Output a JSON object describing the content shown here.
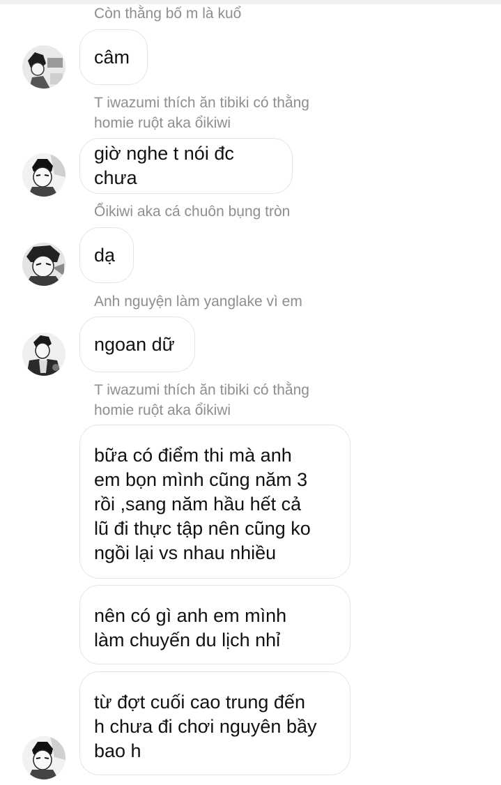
{
  "messages": [
    {
      "sender": "Còn thằng bố m là kuổ"
    },
    {
      "text": "câm"
    },
    {
      "sender": "T iwazumi thích ăn tibiki có thằng\nhomie ruột aka ổikiwi"
    },
    {
      "text": "giờ nghe t nói đc chưa"
    },
    {
      "sender": "Ổikiwi aka cá chuôn bụng tròn"
    },
    {
      "text": "dạ"
    },
    {
      "sender": "Anh nguyện làm yanglake vì em"
    },
    {
      "text": "ngoan dữ"
    },
    {
      "sender": "T iwazumi thích ăn tibiki có thằng\nhomie ruột aka ổikiwi"
    },
    {
      "text": "bữa có điểm thi mà anh\nem bọn mình cũng năm 3\nrồi ,sang năm hầu hết cả\nlũ đi thực tập nên cũng ko\nngồi lại vs nhau nhiều"
    },
    {
      "text": "nên có gì anh em mình\nlàm chuyến du lịch nhỉ"
    },
    {
      "text": "từ đợt cuối cao trung đến\nh chưa đi chơi nguyên bầy\nbao h"
    }
  ],
  "avatars": [
    {
      "icon": "manga-avatar-icon"
    },
    {
      "icon": "manga-avatar-icon"
    },
    {
      "icon": "manga-avatar-icon"
    },
    {
      "icon": "manga-avatar-icon"
    },
    {
      "icon": "manga-avatar-icon"
    }
  ]
}
